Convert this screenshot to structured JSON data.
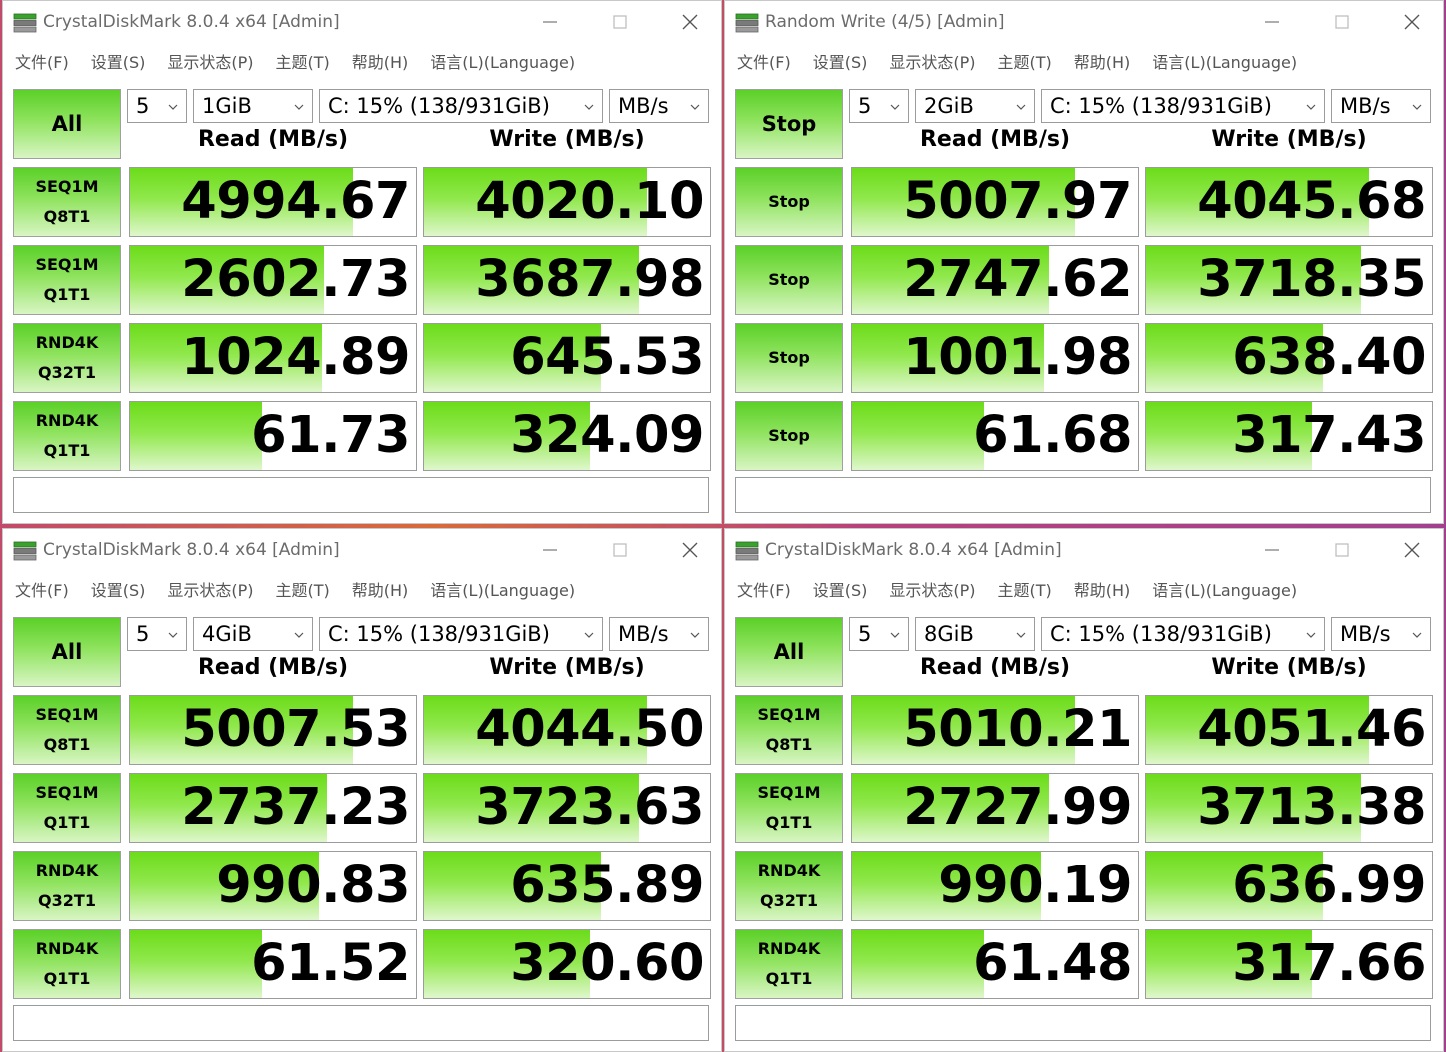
{
  "menu": [
    "文件(F)",
    "设置(S)",
    "显示状态(P)",
    "主题(T)",
    "帮助(H)",
    "语言(L)(Language)"
  ],
  "headers": {
    "read": "Read (MB/s)",
    "write": "Write (MB/s)"
  },
  "colors": {
    "bar_green": "#6cdc1a",
    "button_green": "#5bd028"
  },
  "windows": [
    {
      "title": "CrystalDiskMark 8.0.4 x64 [Admin]",
      "run_label": "All",
      "count": "5",
      "size": "1GiB",
      "drive": "C: 15% (138/931GiB)",
      "unit": "MB/s",
      "rows": [
        {
          "line1": "SEQ1M",
          "line2": "Q8T1",
          "read": "4994.67",
          "read_level": 0.78,
          "write": "4020.10",
          "write_level": 0.78
        },
        {
          "line1": "SEQ1M",
          "line2": "Q1T1",
          "read": "2602.73",
          "read_level": 0.68,
          "write": "3687.98",
          "write_level": 0.75
        },
        {
          "line1": "RND4K",
          "line2": "Q32T1",
          "read": "1024.89",
          "read_level": 0.67,
          "write": "645.53",
          "write_level": 0.62
        },
        {
          "line1": "RND4K",
          "line2": "Q1T1",
          "read": "61.73",
          "read_level": 0.46,
          "write": "324.09",
          "write_level": 0.58
        }
      ]
    },
    {
      "title": "Random Write (4/5) [Admin]",
      "run_label": "Stop",
      "count": "5",
      "size": "2GiB",
      "drive": "C: 15% (138/931GiB)",
      "unit": "MB/s",
      "rows": [
        {
          "line1": "Stop",
          "line2": "",
          "read": "5007.97",
          "read_level": 0.78,
          "write": "4045.68",
          "write_level": 0.78
        },
        {
          "line1": "Stop",
          "line2": "",
          "read": "2747.62",
          "read_level": 0.69,
          "write": "3718.35",
          "write_level": 0.75
        },
        {
          "line1": "Stop",
          "line2": "",
          "read": "1001.98",
          "read_level": 0.67,
          "write": "638.40",
          "write_level": 0.62
        },
        {
          "line1": "Stop",
          "line2": "",
          "read": "61.68",
          "read_level": 0.46,
          "write": "317.43",
          "write_level": 0.58
        }
      ]
    },
    {
      "title": "CrystalDiskMark 8.0.4 x64 [Admin]",
      "run_label": "All",
      "count": "5",
      "size": "4GiB",
      "drive": "C: 15% (138/931GiB)",
      "unit": "MB/s",
      "rows": [
        {
          "line1": "SEQ1M",
          "line2": "Q8T1",
          "read": "5007.53",
          "read_level": 0.78,
          "write": "4044.50",
          "write_level": 0.78
        },
        {
          "line1": "SEQ1M",
          "line2": "Q1T1",
          "read": "2737.23",
          "read_level": 0.69,
          "write": "3723.63",
          "write_level": 0.75
        },
        {
          "line1": "RND4K",
          "line2": "Q32T1",
          "read": "990.83",
          "read_level": 0.66,
          "write": "635.89",
          "write_level": 0.62
        },
        {
          "line1": "RND4K",
          "line2": "Q1T1",
          "read": "61.52",
          "read_level": 0.46,
          "write": "320.60",
          "write_level": 0.58
        }
      ]
    },
    {
      "title": "CrystalDiskMark 8.0.4 x64 [Admin]",
      "run_label": "All",
      "count": "5",
      "size": "8GiB",
      "drive": "C: 15% (138/931GiB)",
      "unit": "MB/s",
      "rows": [
        {
          "line1": "SEQ1M",
          "line2": "Q8T1",
          "read": "5010.21",
          "read_level": 0.78,
          "write": "4051.46",
          "write_level": 0.78
        },
        {
          "line1": "SEQ1M",
          "line2": "Q1T1",
          "read": "2727.99",
          "read_level": 0.69,
          "write": "3713.38",
          "write_level": 0.75
        },
        {
          "line1": "RND4K",
          "line2": "Q32T1",
          "read": "990.19",
          "read_level": 0.66,
          "write": "636.99",
          "write_level": 0.62
        },
        {
          "line1": "RND4K",
          "line2": "Q1T1",
          "read": "61.48",
          "read_level": 0.46,
          "write": "317.66",
          "write_level": 0.58
        }
      ]
    }
  ]
}
